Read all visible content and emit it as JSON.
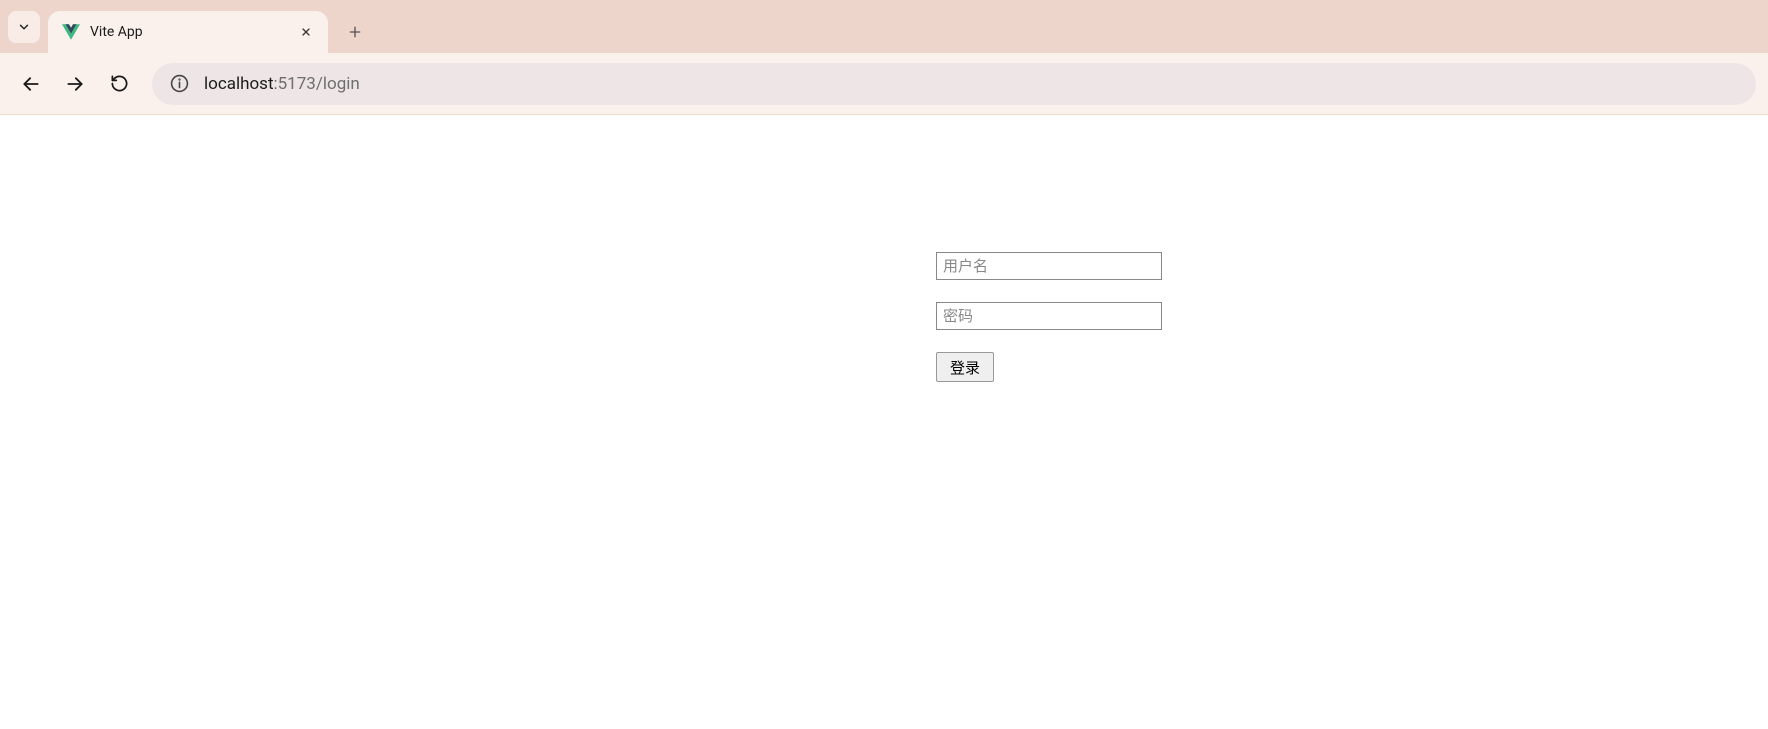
{
  "browser": {
    "tab_title": "Vite App",
    "url_host": "localhost",
    "url_rest": ":5173/login"
  },
  "form": {
    "username_placeholder": "用户名",
    "password_placeholder": "密码",
    "login_button": "登录"
  }
}
